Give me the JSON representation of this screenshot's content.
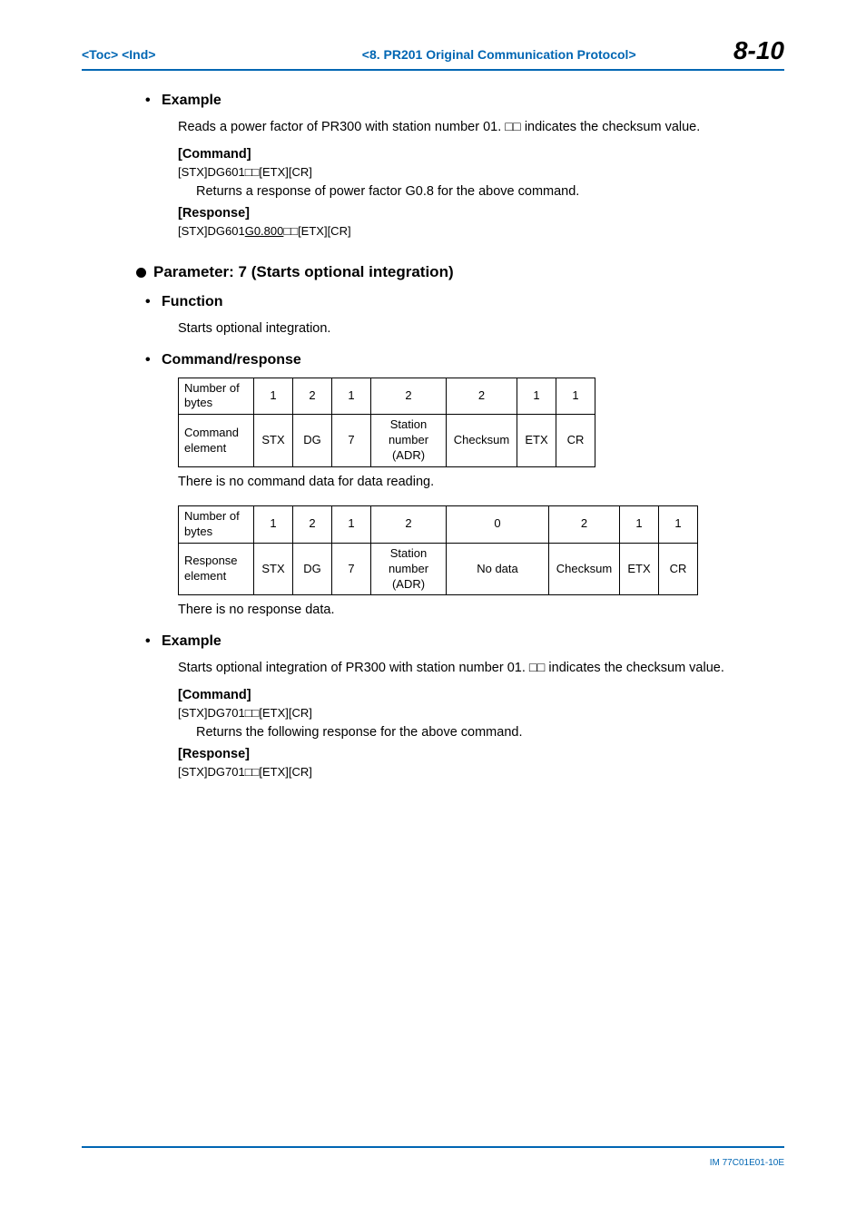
{
  "header": {
    "left": "<Toc> <Ind>",
    "center": "<8.  PR201 Original Communication Protocol>",
    "page_num": "8-10"
  },
  "example1": {
    "heading": "Example",
    "intro": "Reads a power factor of PR300 with station number 01. □□ indicates the checksum value.",
    "command_label": "[Command]",
    "command_text": "[STX]DG601□□[ETX][CR]",
    "command_desc": "Returns a response of power factor G0.8 for the above command.",
    "response_label": "[Response]",
    "response_prefix": "[STX]DG601",
    "response_underline": "G0.800",
    "response_suffix": "□□[ETX][CR]"
  },
  "parameter": {
    "heading": "Parameter: 7 (Starts optional integration)",
    "function_heading": "Function",
    "function_text": "Starts optional integration.",
    "cmdresp_heading": "Command/response",
    "table1_row1_label": "Number of bytes",
    "table1_row1": [
      "1",
      "2",
      "1",
      "2",
      "2",
      "1",
      "1"
    ],
    "table1_row2_label": "Command element",
    "table1_row2": [
      "STX",
      "DG",
      "7",
      "Station number (ADR)",
      "Checksum",
      "ETX",
      "CR"
    ],
    "note1": "There is no command data for data reading.",
    "table2_row1_label": "Number of bytes",
    "table2_row1": [
      "1",
      "2",
      "1",
      "2",
      "0",
      "2",
      "1",
      "1"
    ],
    "table2_row2_label": "Response element",
    "table2_row2": [
      "STX",
      "DG",
      "7",
      "Station number (ADR)",
      "No data",
      "Checksum",
      "ETX",
      "CR"
    ],
    "note2": "There is no response data."
  },
  "example2": {
    "heading": "Example",
    "intro": "Starts optional integration of PR300 with station number 01. □□ indicates the checksum value.",
    "command_label": "[Command]",
    "command_text": "[STX]DG701□□[ETX][CR]",
    "command_desc": "Returns the following response for the above command.",
    "response_label": "[Response]",
    "response_text": "[STX]DG701□□[ETX][CR]"
  },
  "footer": "IM 77C01E01-10E"
}
